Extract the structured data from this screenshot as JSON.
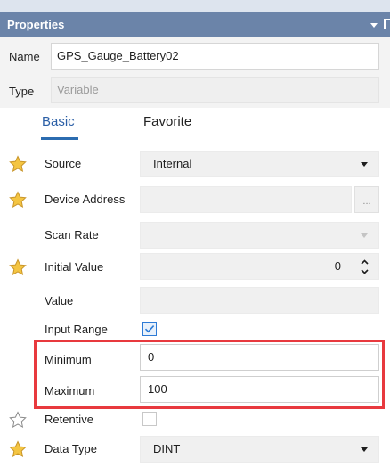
{
  "panel": {
    "title": "Properties"
  },
  "header": {
    "name_label": "Name",
    "name_value": "GPS_Gauge_Battery02",
    "type_label": "Type",
    "type_value": "Variable"
  },
  "tabs": [
    {
      "label": "Basic",
      "active": true
    },
    {
      "label": "Favorite",
      "active": false
    }
  ],
  "rows": {
    "source": {
      "label": "Source",
      "value": "Internal",
      "favorite": true
    },
    "device_address": {
      "label": "Device Address",
      "value": "",
      "button": "...",
      "favorite": true
    },
    "scan_rate": {
      "label": "Scan Rate",
      "value": "",
      "favorite": false
    },
    "initial_value": {
      "label": "Initial Value",
      "value": "0",
      "favorite": true
    },
    "value": {
      "label": "Value",
      "value": "",
      "favorite": false
    },
    "input_range": {
      "label": "Input Range",
      "checked": true,
      "favorite": false
    },
    "minimum": {
      "label": "Minimum",
      "value": "0",
      "favorite": false
    },
    "maximum": {
      "label": "Maximum",
      "value": "100",
      "favorite": false
    },
    "retentive": {
      "label": "Retentive",
      "checked": false,
      "favorite": false
    },
    "data_type": {
      "label": "Data Type",
      "value": "DINT",
      "favorite": true
    }
  },
  "colors": {
    "title_bar": "#6b84a9",
    "accent": "#2b6cb0",
    "star_fill": "#f4c542",
    "highlight": "#e8393e"
  }
}
